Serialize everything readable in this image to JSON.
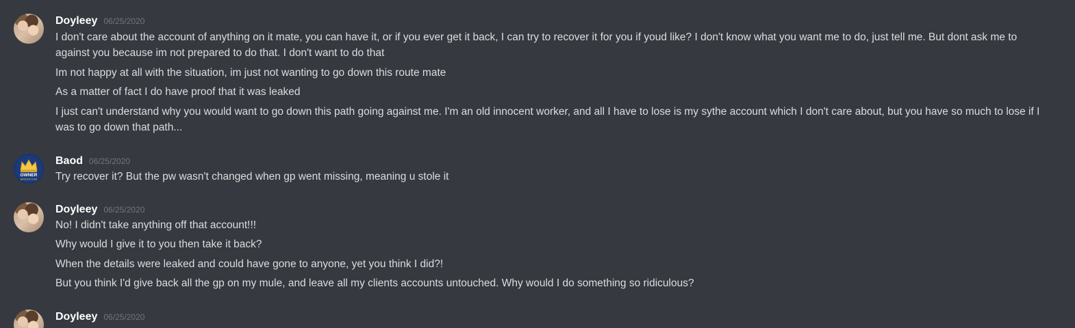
{
  "groups": [
    {
      "author": "Doyleey",
      "timestamp": "06/25/2020",
      "avatar": "doyleey-avatar",
      "messages": [
        "I don't care about the account of anything on it mate, you can have it, or if you ever get it back, I can try to recover it for you if youd like? I don't know what you want me to do, just tell me. But dont ask me to against you because im not prepared to do that. I don't want to do that",
        "Im not happy at all with the situation, im just not wanting to go down this route mate",
        "As a matter of fact I do have proof that it was leaked",
        "I just can't understand why you would want to go down this path going against me. I'm an old innocent worker, and all I have to lose is my sythe account which I don't care about, but you have so much to lose if I was to go down that path..."
      ]
    },
    {
      "author": "Baod",
      "timestamp": "06/25/2020",
      "avatar": "baod-avatar",
      "avatar_text": [
        "OWNER",
        "BAODGP.COM"
      ],
      "messages": [
        "Try recover it? But the pw wasn't changed when gp went missing, meaning u stole it"
      ]
    },
    {
      "author": "Doyleey",
      "timestamp": "06/25/2020",
      "avatar": "doyleey-avatar",
      "messages": [
        "No! I didn't take anything off that account!!!",
        "Why would I give it to you then take it back?",
        "When the details were leaked and could have gone to anyone, yet you think I did?!",
        "But you think I'd give back all the gp on my mule, and leave all my clients accounts untouched. Why would I do something so ridiculous?"
      ]
    },
    {
      "author": "Doyleey",
      "timestamp": "06/25/2020",
      "avatar": "doyleey-avatar",
      "messages": []
    }
  ],
  "colors": {
    "background": "#36393f",
    "username": "#ffffff",
    "timestamp": "#72767d",
    "message_text": "#dcddde"
  }
}
